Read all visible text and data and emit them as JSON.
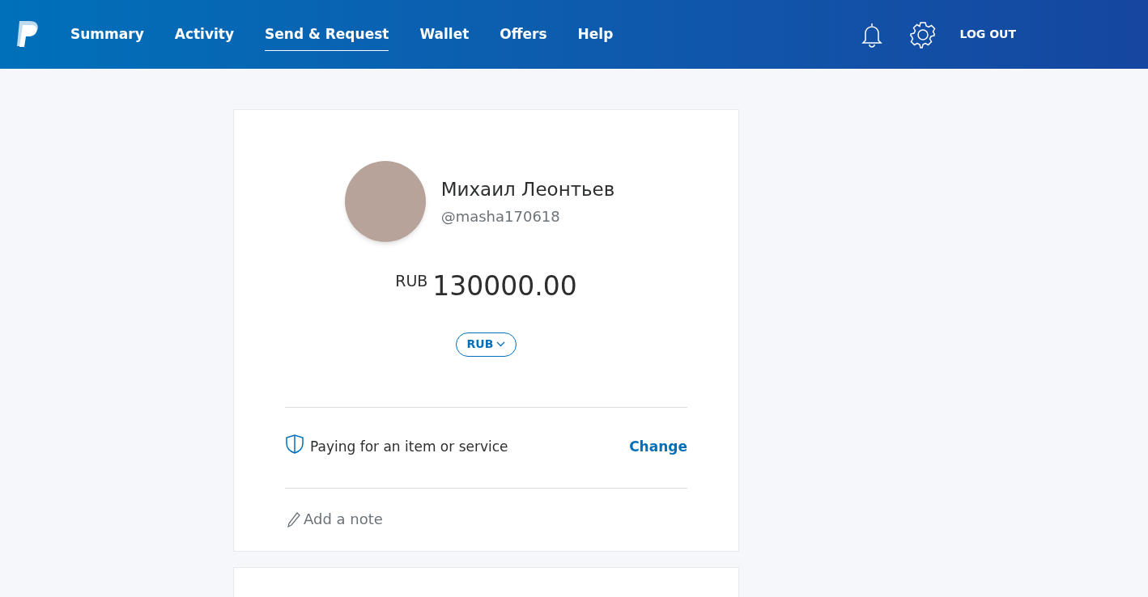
{
  "nav": {
    "items": [
      {
        "label": "Summary",
        "selected": false
      },
      {
        "label": "Activity",
        "selected": false
      },
      {
        "label": "Send & Request",
        "selected": true
      },
      {
        "label": "Wallet",
        "selected": false
      },
      {
        "label": "Offers",
        "selected": false
      },
      {
        "label": "Help",
        "selected": false
      }
    ],
    "logout": "LOG OUT"
  },
  "recipient": {
    "name": "Михаил Леонтьев",
    "handle": "@masha170618"
  },
  "amount": {
    "currency": "RUB",
    "value": "130000.00"
  },
  "currency_button": "RUB",
  "payment_type": {
    "label": "Paying for an item or service",
    "action": "Change"
  },
  "note": {
    "placeholder": "Add a note"
  }
}
